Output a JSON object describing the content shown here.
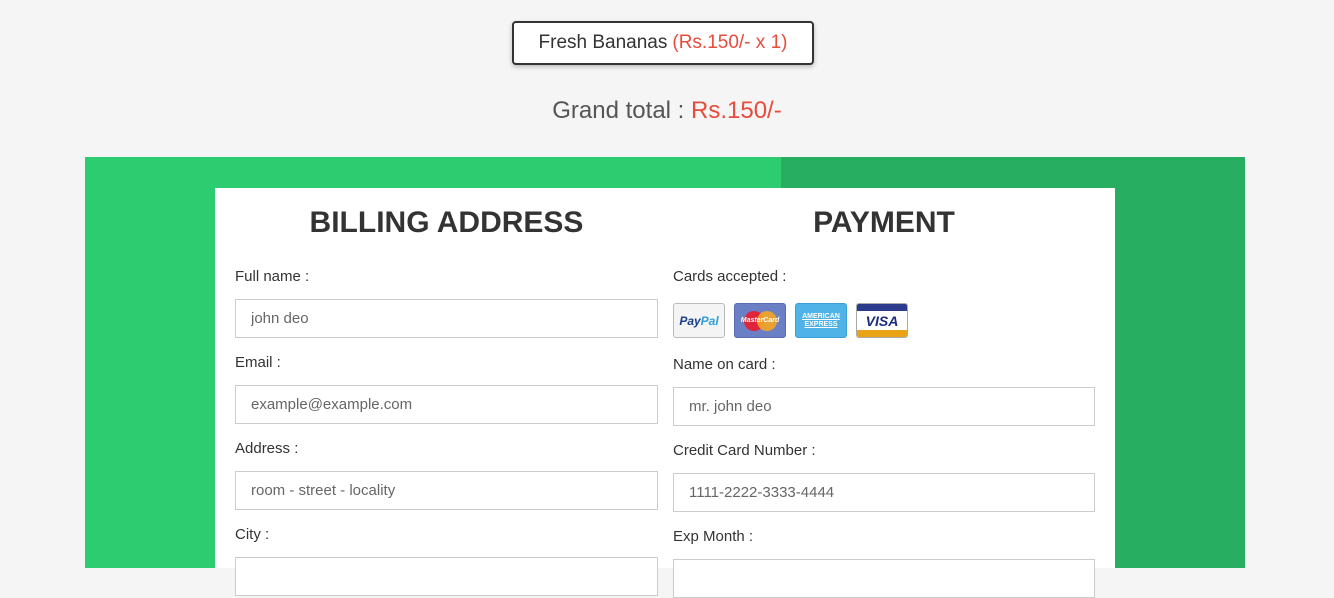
{
  "order": {
    "item_name": "Fresh Bananas",
    "item_price": "(Rs.150/- x 1)"
  },
  "grand_total": {
    "label": "Grand total :",
    "amount": "Rs.150/-"
  },
  "billing": {
    "title": "BILLING ADDRESS",
    "full_name_label": "Full name :",
    "full_name_placeholder": "john deo",
    "email_label": "Email :",
    "email_placeholder": "example@example.com",
    "address_label": "Address :",
    "address_placeholder": "room - street - locality",
    "city_label": "City :"
  },
  "payment": {
    "title": "PAYMENT",
    "cards_label": "Cards accepted :",
    "cards": [
      {
        "icon": "paypal-icon",
        "text": "PayPal"
      },
      {
        "icon": "mastercard-icon",
        "text": "MasterCard"
      },
      {
        "icon": "amex-icon",
        "text": "AMERICAN EXPRESS"
      },
      {
        "icon": "visa-icon",
        "text": "VISA"
      }
    ],
    "name_on_card_label": "Name on card :",
    "name_on_card_placeholder": "mr. john deo",
    "card_number_label": "Credit Card Number :",
    "card_number_placeholder": "1111-2222-3333-4444",
    "exp_month_label": "Exp Month :"
  },
  "colors": {
    "accent_red": "#e74c3c",
    "green_light": "#2ecc71",
    "green_dark": "#27ae60"
  }
}
